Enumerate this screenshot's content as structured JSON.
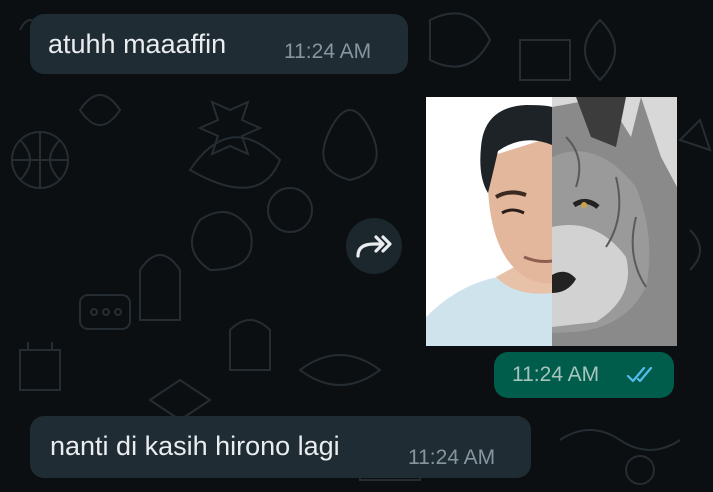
{
  "messages": [
    {
      "direction": "incoming",
      "text": "atuhh maaaffin",
      "time": "11:24 AM"
    },
    {
      "direction": "outgoing",
      "type": "image",
      "time": "11:24 AM",
      "status": "read",
      "ticks_icon": "double-check-icon"
    },
    {
      "direction": "incoming",
      "text": "nanti di kasih hirono lagi",
      "time": "11:24 AM"
    }
  ],
  "actions": {
    "forward_icon": "forward-icon"
  },
  "colors": {
    "background": "#0b0f12",
    "incoming_bubble": "#202c33",
    "outgoing_bubble": "#005c4b",
    "read_ticks": "#53bdeb",
    "text": "#e9edef",
    "timestamp": "#8696a0"
  }
}
